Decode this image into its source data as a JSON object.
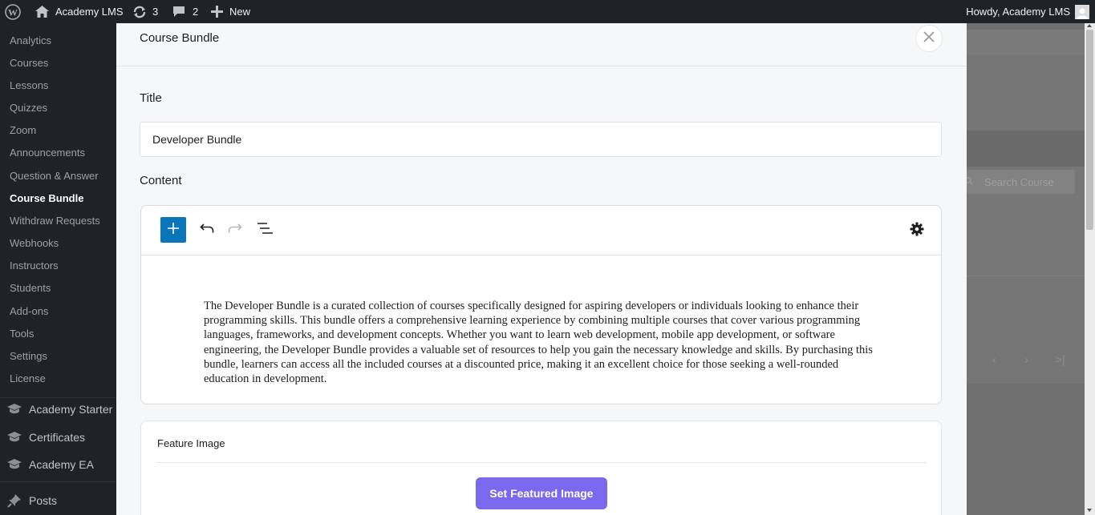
{
  "adminbar": {
    "site_name": "Academy LMS",
    "updates_count": "3",
    "comments_count": "2",
    "new_label": "New",
    "howdy": "Howdy, Academy LMS"
  },
  "sidebar": {
    "items": [
      {
        "label": "Analytics"
      },
      {
        "label": "Courses"
      },
      {
        "label": "Lessons"
      },
      {
        "label": "Quizzes"
      },
      {
        "label": "Zoom"
      },
      {
        "label": "Announcements"
      },
      {
        "label": "Question & Answer"
      },
      {
        "label": "Course Bundle"
      },
      {
        "label": "Withdraw Requests"
      },
      {
        "label": "Webhooks"
      },
      {
        "label": "Instructors"
      },
      {
        "label": "Students"
      },
      {
        "label": "Add-ons"
      },
      {
        "label": "Tools"
      },
      {
        "label": "Settings"
      },
      {
        "label": "License"
      }
    ],
    "active_item": "Course Bundle",
    "sections": [
      {
        "label": "Academy Starter",
        "icon": "graduation-cap-icon"
      },
      {
        "label": "Certificates",
        "icon": "graduation-cap-icon"
      },
      {
        "label": "Academy EA",
        "icon": "graduation-cap-icon"
      },
      {
        "label": "Posts",
        "icon": "pushpin-icon"
      }
    ]
  },
  "background": {
    "search_placeholder": "Search Course",
    "pagination": [
      "‹",
      "›",
      ">|"
    ]
  },
  "modal": {
    "title": "Course Bundle",
    "title_label": "Title",
    "title_value": "Developer Bundle",
    "content_label": "Content",
    "content_text": "The Developer Bundle is a curated collection of courses specifically designed for aspiring developers or individuals looking to enhance their programming skills. This bundle offers a comprehensive learning experience by combining multiple courses that cover various programming languages, frameworks, and development concepts. Whether you want to learn web development, mobile app development, or software engineering, the Developer Bundle provides a valuable set of resources to help you gain the necessary knowledge and skills. By purchasing this bundle, learners can access all the included courses at a discounted price, making it an excellent choice for those seeking a well-rounded education in development.",
    "feature_image_label": "Feature Image",
    "set_featured_label": "Set Featured Image"
  },
  "colors": {
    "adminbar_bg": "#1d2327",
    "accent_blue": "#0a75b8",
    "button_purple": "#7b68ee"
  }
}
